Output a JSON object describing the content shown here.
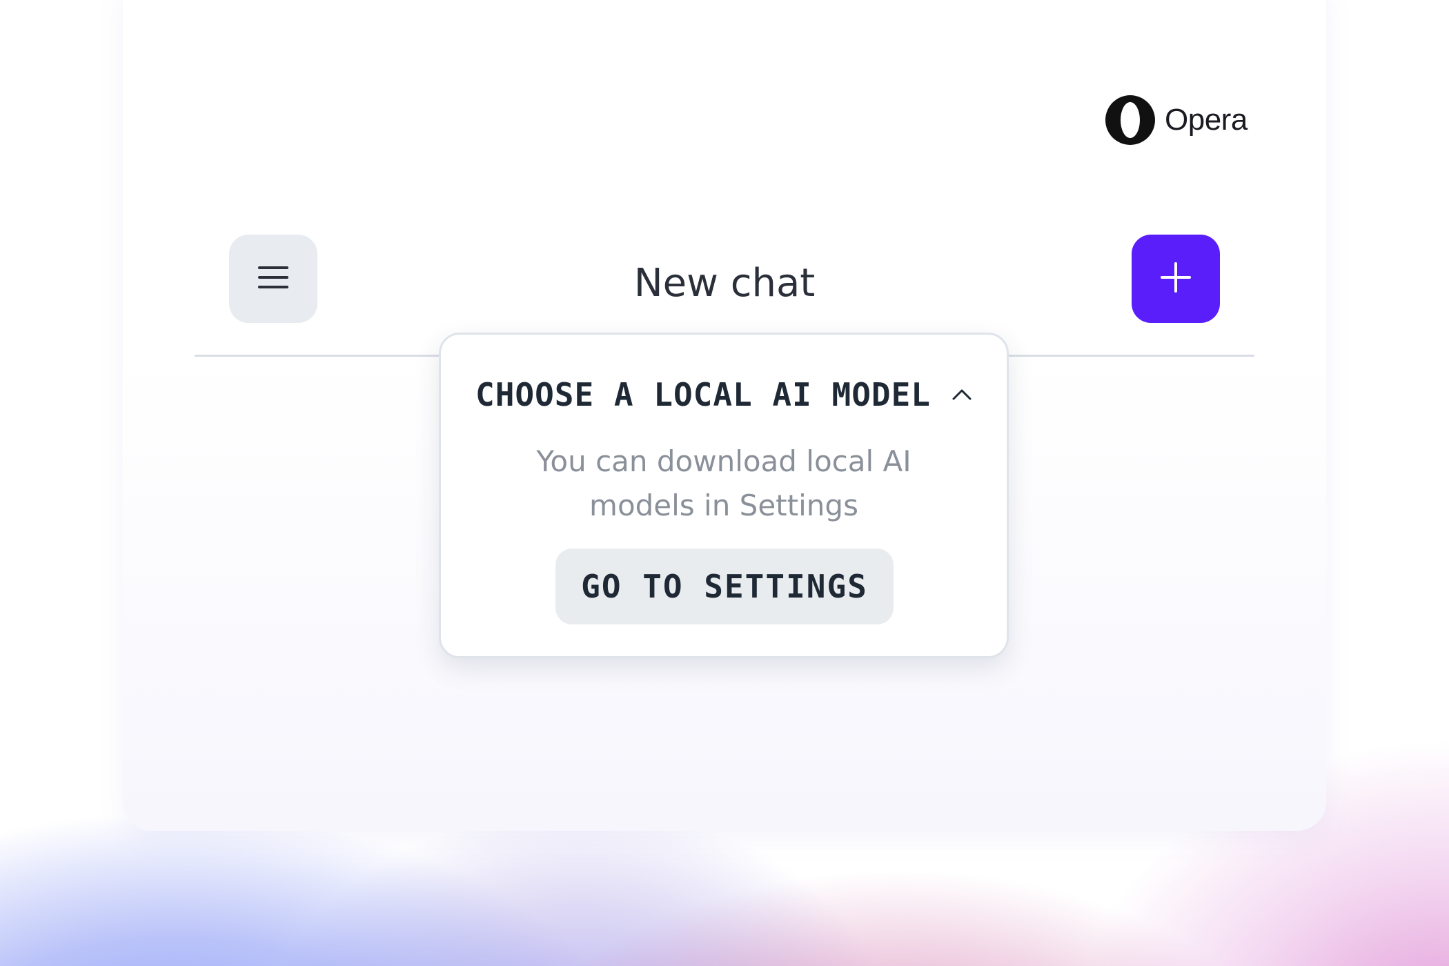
{
  "brand": {
    "name": "Opera",
    "icon": "opera-logo-icon"
  },
  "header": {
    "title": "New chat",
    "menu_icon": "hamburger-menu-icon",
    "new_chat_icon": "plus-icon"
  },
  "model_picker": {
    "title": "CHOOSE A LOCAL AI MODEL",
    "expand_icon": "chevron-up-icon",
    "message_line_1": "You can download local AI",
    "message_line_2": "models in Settings",
    "button_label": "GO TO SETTINGS"
  },
  "colors": {
    "accent": "#5A1EFB",
    "text_dark": "#1F2935",
    "text_muted": "#8A9099",
    "button_bg": "#E9ECEF"
  }
}
